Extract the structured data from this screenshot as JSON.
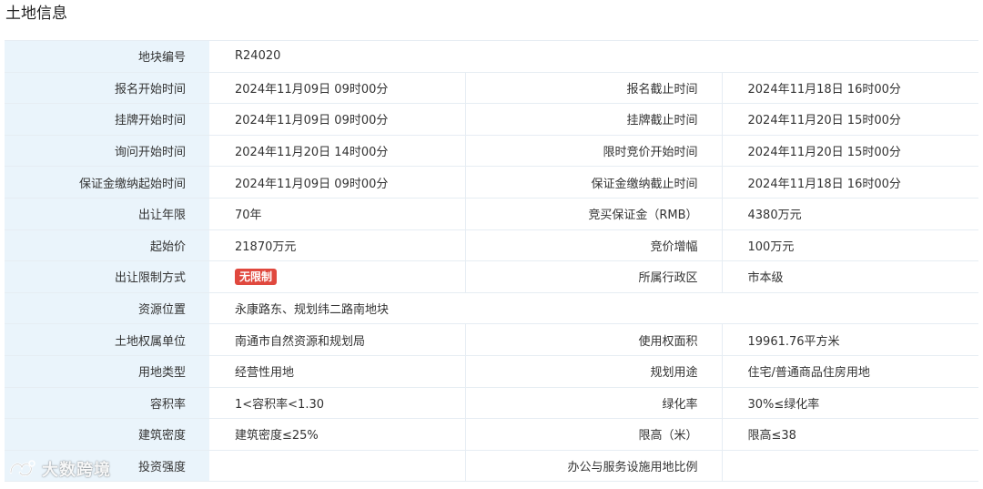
{
  "section_title": "土地信息",
  "badge_color": "#e0483e",
  "label_bg": "#eaf4fb",
  "watermark": {
    "text": "大数跨境",
    "icon": "brand-logo-icon"
  },
  "rows": [
    {
      "l1": "地块编号",
      "v1": "R24020",
      "full": true
    },
    {
      "l1": "报名开始时间",
      "v1": "2024年11月09日 09时00分",
      "l2": "报名截止时间",
      "v2": "2024年11月18日 16时00分"
    },
    {
      "l1": "挂牌开始时间",
      "v1": "2024年11月09日 09时00分",
      "l2": "挂牌截止时间",
      "v2": "2024年11月20日 15时00分"
    },
    {
      "l1": "询问开始时间",
      "v1": "2024年11月20日 14时00分",
      "l2": "限时竞价开始时间",
      "v2": "2024年11月20日 15时00分"
    },
    {
      "l1": "保证金缴纳起始时间",
      "v1": "2024年11月09日 09时00分",
      "l2": "保证金缴纳截止时间",
      "v2": "2024年11月18日 16时00分"
    },
    {
      "l1": "出让年限",
      "v1": "70年",
      "l2": "竞买保证金（RMB）",
      "v2": "4380万元"
    },
    {
      "l1": "起始价",
      "v1": "21870万元",
      "l2": "竞价增幅",
      "v2": "100万元"
    },
    {
      "l1": "出让限制方式",
      "v1": "无限制",
      "v1_badge": true,
      "l2": "所属行政区",
      "v2": "市本级"
    },
    {
      "l1": "资源位置",
      "v1": "永康路东、规划纬二路南地块",
      "full": true
    },
    {
      "l1": "土地权属单位",
      "v1": "南通市自然资源和规划局",
      "l2": "使用权面积",
      "v2": "19961.76平方米"
    },
    {
      "l1": "用地类型",
      "v1": "经营性用地",
      "l2": "规划用途",
      "v2": "住宅/普通商品住房用地"
    },
    {
      "l1": "容积率",
      "v1": "1<容积率<1.30",
      "l2": "绿化率",
      "v2": "30%≤绿化率"
    },
    {
      "l1": "建筑密度",
      "v1": "建筑密度≤25%",
      "l2": "限高（米）",
      "v2": "限高≤38"
    },
    {
      "l1": "投资强度",
      "v1": "",
      "l2": "办公与服务设施用地比例",
      "v2": ""
    }
  ]
}
